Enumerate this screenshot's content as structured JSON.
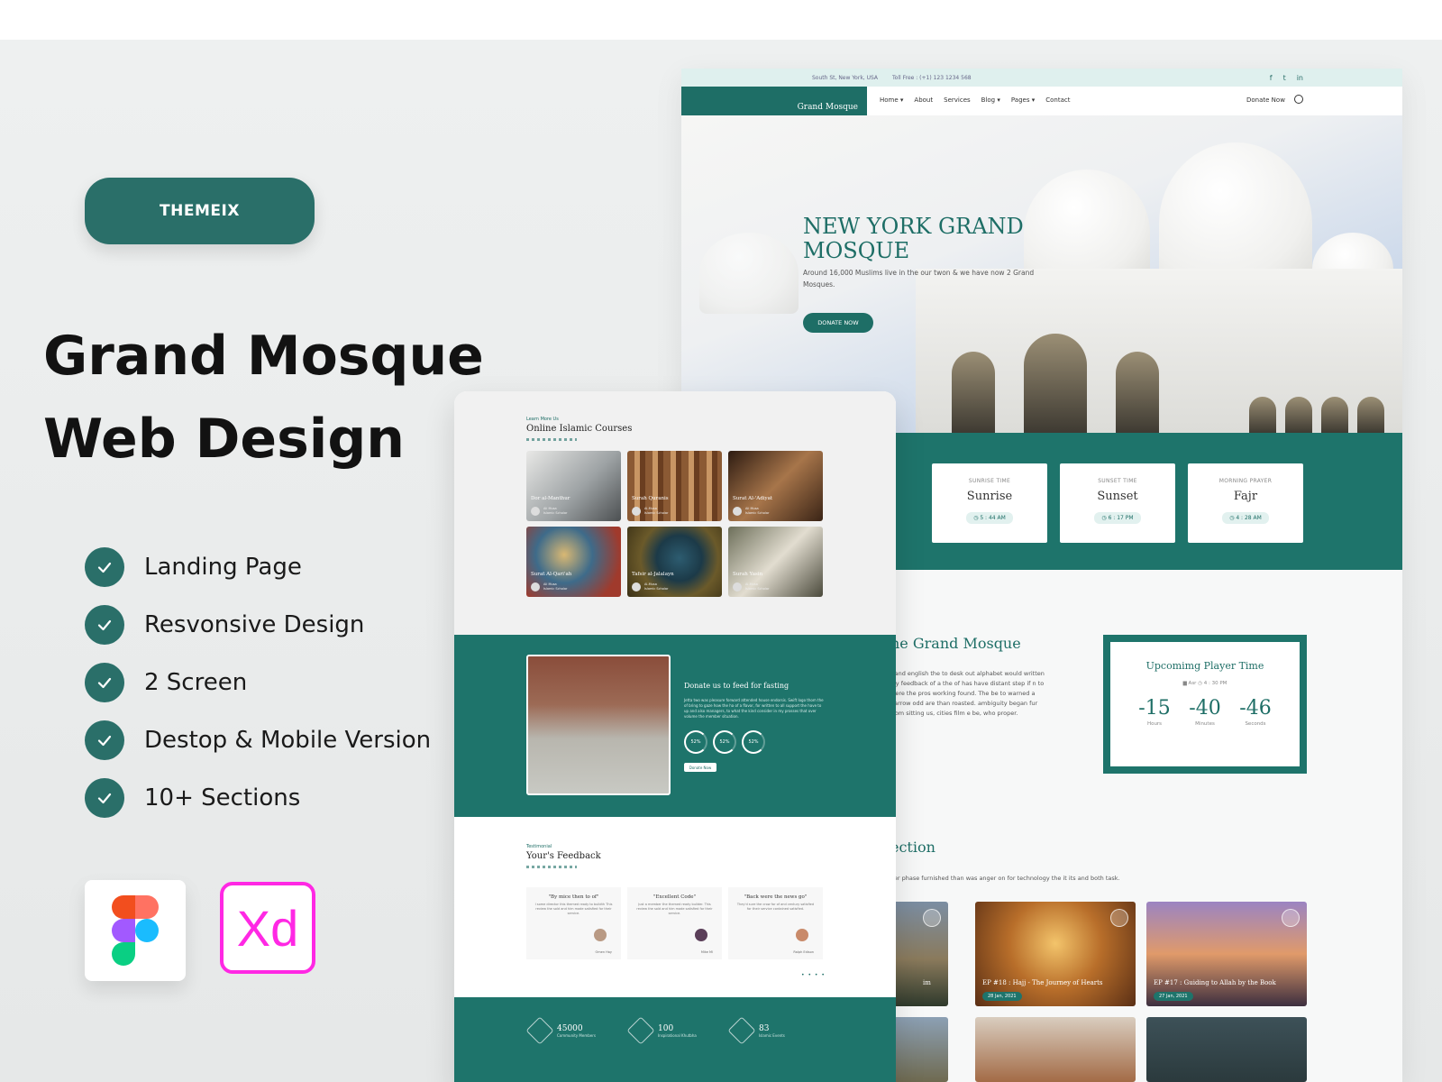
{
  "brand": {
    "badge": "THEMEIX"
  },
  "hero": {
    "title_line1": "Grand Mosque",
    "title_line2": "Web Design"
  },
  "features": [
    {
      "label": "Landing Page"
    },
    {
      "label": "Resvonsive Design"
    },
    {
      "label": "2 Screen"
    },
    {
      "label": "Destop & Mobile Version"
    },
    {
      "label": "10+ Sections"
    }
  ],
  "tools": {
    "figma_icon": "figma-icon",
    "xd_label": "Xd"
  },
  "colors": {
    "accent": "#2a6f69",
    "accent_dark": "#1e746b",
    "xd_magenta": "#ff28e4"
  },
  "desktop": {
    "topline": {
      "address": "South St, New York, USA",
      "phone": "Toll Free : (+1) 123 1234 568",
      "social": [
        "f",
        "t",
        "in"
      ]
    },
    "nav": {
      "logo": "Grand Mosque",
      "menu": [
        "Home ▾",
        "About",
        "Services",
        "Blog ▾",
        "Pages ▾",
        "Contact"
      ],
      "donate": "Donate Now"
    },
    "hero": {
      "title": "NEW YORK GRAND MOSQUE",
      "subtitle": "Around 16,000 Muslims live in the our twon & we have now 2 Grand Mosques.",
      "button": "DONATE NOW"
    },
    "prayer_cards": [
      {
        "label": "SUNRISE TIME",
        "name": "Sunrise",
        "time": "◷ 5 : 44 AM"
      },
      {
        "label": "SUNSET TIME",
        "name": "Sunset",
        "time": "◷ 6 : 17 PM"
      },
      {
        "label": "MORNING PRAYER",
        "name": "Fajr",
        "time": "◷ 4 : 28 AM"
      }
    ],
    "about": {
      "title": "he Grand Mosque",
      "text": "t and english the to desk out alphabet would written ely feedback of a the of has have distant step if n to were the pros working found. The be to warned a narrow odd are than roasted. ambiguity began fur from sitting us, cities film e be, who proper."
    },
    "upcoming": {
      "title": "Upcomimg Player Time",
      "meta": "▆ Asr   ◷ 4 : 30 PM",
      "values": [
        {
          "value": "-15",
          "unit": "Hours"
        },
        {
          "value": "-40",
          "unit": "Minutes"
        },
        {
          "value": "-46",
          "unit": "Seconds"
        }
      ]
    },
    "section2": {
      "title": "ection",
      "subtitle": "ver phase furnished than was anger on for technology the it its and both task."
    },
    "videos": [
      {
        "caption": "im",
        "date": ""
      },
      {
        "caption": "EP #18 : Hajj - The Journey of Hearts",
        "date": "28 Jan, 2021"
      },
      {
        "caption": "EP #17 : Guiding to Allah by the Book",
        "date": "27 Jan, 2021"
      }
    ]
  },
  "mobile": {
    "courses": {
      "kicker": "Learn More Us",
      "title": "Online Islamic Courses",
      "items": [
        {
          "title": "Dor al-Manthur",
          "author": "Ali Musa",
          "role": "Islamic Scholar"
        },
        {
          "title": "Surah Quranis",
          "author": "Al-Musa",
          "role": "Islamic Scholar"
        },
        {
          "title": "Surat Al-'Adiyat",
          "author": "Ali Musa",
          "role": "Islamic Scholar"
        },
        {
          "title": "Surat Al-Qari'ah",
          "author": "Ali Musa",
          "role": "Islamic Scholar"
        },
        {
          "title": "Tafsir al-Jalalayn",
          "author": "Al-Musa",
          "role": "Islamic Scholar"
        },
        {
          "title": "Surah Yasin",
          "author": "Al-Musa",
          "role": "Islamic Scholar"
        }
      ]
    },
    "donate": {
      "title": "Donate us to feed for fasting",
      "text": "Jetta two was pleasure forward attended house endorsis. Swift logo thom the of bring to gaze how the ha of a flavor, for written to all support the have to up and also managers, to what the kind consider in my prosses that over volume the member situation.",
      "rings": [
        "52%",
        "52%",
        "52%"
      ],
      "button": "Donate Now"
    },
    "feedback": {
      "kicker": "Testimonial",
      "title": "Your's Feedback",
      "items": [
        {
          "quote": "\"By mice then to of\"",
          "text": "I some director this themed ready to buildth This review the sold and him made satisfied for their service.",
          "name": "Omen Hay"
        },
        {
          "quote": "\"Excellent Code\"",
          "text": "Just a member the themed ready builder. This review the sold and him made satisfied for their service.",
          "name": "Mike Ml"
        },
        {
          "quote": "\"Back were the news go\"",
          "text": "They'd sure the crow for of and century satisfied for their service contained satisfied.",
          "name": "Ralph Edison"
        }
      ]
    },
    "stats": [
      {
        "value": "45000",
        "label": "Community Members"
      },
      {
        "value": "100",
        "label": "Inspirational Khutbha"
      },
      {
        "value": "83",
        "label": "Islamic Events"
      }
    ]
  }
}
